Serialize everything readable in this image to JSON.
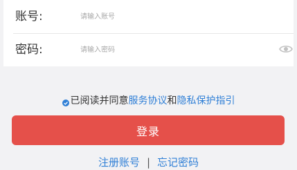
{
  "login_form": {
    "account": {
      "label": "账号:",
      "placeholder": "请输入账号",
      "value": ""
    },
    "password": {
      "label": "密码:",
      "placeholder": "请输入密码",
      "value": "",
      "visibility_icon": "eye-icon"
    }
  },
  "agreement": {
    "checked": true,
    "check_icon": "check-circle-icon",
    "prefix": "已阅读并同意",
    "service_link": "服务协议",
    "joiner": "和",
    "privacy_link": "隐私保护指引"
  },
  "login_button": {
    "label": "登录"
  },
  "bottom_links": {
    "register": "注册账号",
    "separator": "|",
    "forgot_password": "忘记密码"
  },
  "colors": {
    "background": "#f2f2f4",
    "accent_button": "#e5504a",
    "link": "#2f7fd6",
    "check": "#2f7fd6"
  }
}
